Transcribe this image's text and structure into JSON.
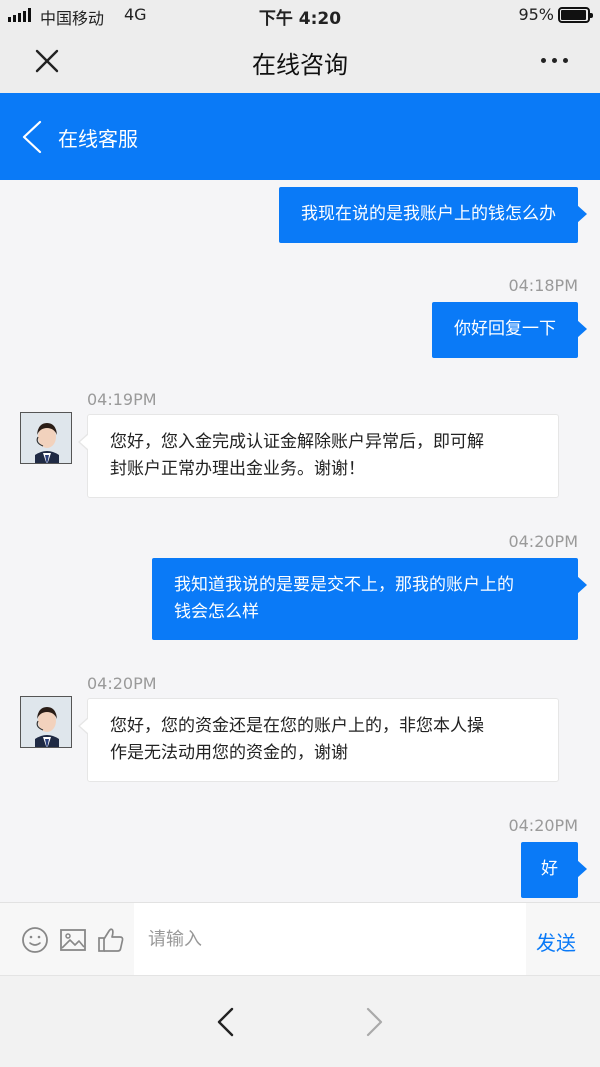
{
  "status_bar": {
    "carrier": "中国移动",
    "network": "4G",
    "time": "下午 4:20",
    "battery_percent": "95%",
    "battery_level": 0.95
  },
  "nav": {
    "title": "在线咨询",
    "close_icon": "close-icon",
    "more_icon": "more-icon"
  },
  "chat_header": {
    "title": "在线客服",
    "back_icon": "chevron-left-icon"
  },
  "messages": [
    {
      "direction": "outgoing",
      "text": "我现在说的是我账户上的钱怎么办"
    },
    {
      "direction": "outgoing",
      "time": "04:18PM",
      "text": "你好回复一下"
    },
    {
      "direction": "incoming",
      "time": "04:19PM",
      "lines": [
        "您好，您入金完成认证金解除账户异常后，即可解",
        "封账户正常办理出金业务。谢谢！"
      ]
    },
    {
      "direction": "outgoing",
      "time": "04:20PM",
      "lines": [
        "我知道我说的是要是交不上，那我的账户上的",
        "钱会怎么样"
      ]
    },
    {
      "direction": "incoming",
      "time": "04:20PM",
      "lines": [
        "您好，您的资金还是在您的账户上的，非您本人操",
        "作是无法动用您的资金的，谢谢"
      ]
    },
    {
      "direction": "outgoing",
      "time": "04:20PM",
      "text": "好"
    }
  ],
  "input_bar": {
    "placeholder": "请输入",
    "send_label": "发送",
    "icons": [
      "emoji-icon",
      "image-icon",
      "thumbs-up-icon"
    ]
  },
  "bottom_nav": {
    "back_icon": "chevron-left-icon",
    "forward_icon": "chevron-right-icon"
  },
  "colors": {
    "accent": "#0a7af7",
    "bar_background": "#ededed",
    "chat_background": "#f5f5f7",
    "timestamp": "#9a9a9a"
  }
}
